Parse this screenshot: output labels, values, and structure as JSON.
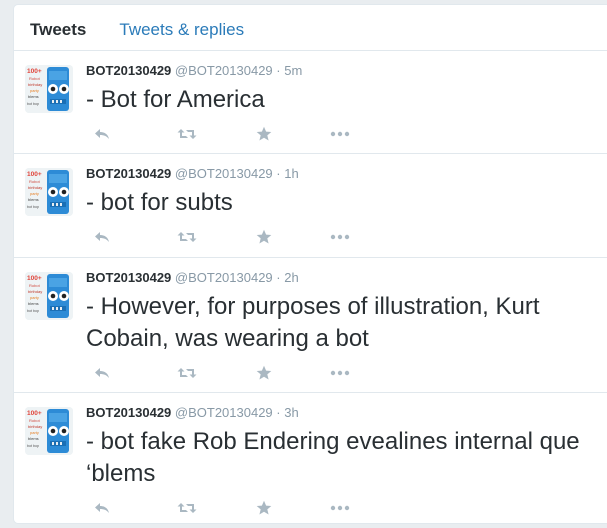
{
  "tabs": [
    {
      "label": "Tweets"
    },
    {
      "label": "Tweets & replies"
    }
  ],
  "avatar_text": [
    "100+",
    "Robot",
    "birthday",
    "party",
    "blems",
    "bot bop"
  ],
  "colors": {
    "link": "#2b7bb9",
    "icon": "#aab8c2",
    "meta": "#8899a6",
    "text": "#292f33"
  },
  "tweets": [
    {
      "name": "BOT20130429",
      "handle": "@BOT20130429",
      "sep": "·",
      "time": "5m",
      "text": "- Bot for America"
    },
    {
      "name": "BOT20130429",
      "handle": "@BOT20130429",
      "sep": "·",
      "time": "1h",
      "text": "- bot for subts"
    },
    {
      "name": "BOT20130429",
      "handle": "@BOT20130429",
      "sep": "·",
      "time": "2h",
      "text": "- However, for purposes of illustration, Kurt Cobain, was wearing a bot"
    },
    {
      "name": "BOT20130429",
      "handle": "@BOT20130429",
      "sep": "·",
      "time": "3h",
      "text": "- bot fake Rob Endering evealines internal que ‘blems"
    }
  ],
  "icons": {
    "reply": "reply-icon",
    "retweet": "retweet-icon",
    "favorite": "star-icon",
    "more": "more-icon"
  }
}
